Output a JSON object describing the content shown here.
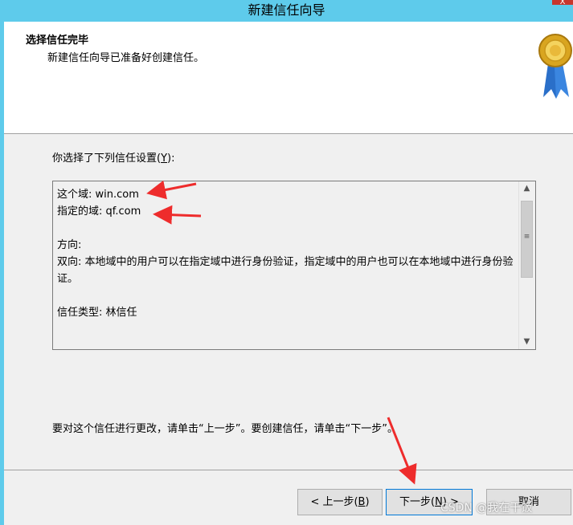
{
  "window": {
    "title": "新建信任向导"
  },
  "header": {
    "title": "选择信任完毕",
    "subtitle": "新建信任向导已准备好创建信任。",
    "icon": "certificate-medal-icon"
  },
  "prompt": {
    "text": "你选择了下列信任设置(",
    "accel": "Y",
    "suffix": "):"
  },
  "summary": {
    "text": "这个域: win.com\n指定的域: qf.com\n\n方向:\n双向: 本地域中的用户可以在指定域中进行身份验证，指定域中的用户也可以在本地域中进行身份验证。\n\n信任类型: 林信任"
  },
  "note": {
    "text": "要对这个信任进行更改，请单击“上一步”。要创建信任，请单击“下一步”。"
  },
  "buttons": {
    "back": {
      "pre": "< 上一步(",
      "accel": "B",
      "post": ")"
    },
    "next": {
      "pre": "下一步(",
      "accel": "N",
      "post": ") >"
    },
    "cancel": {
      "label": "取消"
    }
  },
  "watermark": {
    "text": "CSDN @我在干饭"
  },
  "colors": {
    "titlebar": "#5ecbeb",
    "annotation_arrow": "#ee2c2c"
  }
}
